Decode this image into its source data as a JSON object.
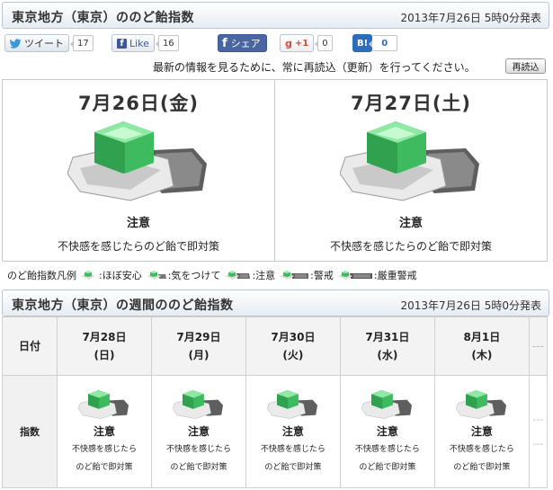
{
  "header": {
    "title": "東京地方（東京）ののど飴指数",
    "issued": "2013年7月26日 5時0分発表"
  },
  "social": {
    "tweet_label": "ツイート",
    "tweet_count": "17",
    "like_label": "Like",
    "like_count": "16",
    "share_label": "シェア",
    "gplus_label": "+1",
    "gplus_count": "0",
    "hatena_label": "B!",
    "hatena_count": "0"
  },
  "notice": {
    "text": "最新の情報を見るために、常に再読込（更新）を行ってください。",
    "reload_label": "再読込"
  },
  "days": [
    {
      "date": "7月26日(金)",
      "level": "注意",
      "desc": "不快感を感じたらのど飴で即対策"
    },
    {
      "date": "7月27日(土)",
      "level": "注意",
      "desc": "不快感を感じたらのど飴で即対策"
    }
  ],
  "legend": {
    "title": "のど飴指数凡例",
    "items": [
      ":ほぼ安心",
      ":気をつけて",
      ":注意",
      ":警戒",
      ":厳重警戒"
    ]
  },
  "weekly": {
    "title": "東京地方（東京）の週間ののど飴指数",
    "issued": "2013年7月26日 5時0分発表",
    "row_date_label": "日付",
    "row_index_label": "指数",
    "dates": [
      {
        "day": "7月28日",
        "weekday": "(日)"
      },
      {
        "day": "7月29日",
        "weekday": "(月)"
      },
      {
        "day": "7月30日",
        "weekday": "(火)"
      },
      {
        "day": "7月31日",
        "weekday": "(水)"
      },
      {
        "day": "8月1日",
        "weekday": "(木)"
      },
      {
        "day": "---",
        "weekday": ""
      }
    ],
    "index": [
      {
        "level": "注意",
        "desc1": "不快感を感じたら",
        "desc2": "のど飴で即対策"
      },
      {
        "level": "注意",
        "desc1": "不快感を感じたら",
        "desc2": "のど飴で即対策"
      },
      {
        "level": "注意",
        "desc1": "不快感を感じたら",
        "desc2": "のど飴で即対策"
      },
      {
        "level": "注意",
        "desc1": "不快感を感じたら",
        "desc2": "のど飴で即対策"
      },
      {
        "level": "注意",
        "desc1": "不快感を感じたら",
        "desc2": "のど飴で即対策"
      },
      {
        "level": "---",
        "desc1": "---",
        "desc2": ""
      }
    ]
  },
  "colors": {
    "candy_green": "#3dbb5e",
    "header_border": "#b9c6d6",
    "facebook_blue": "#3b5998",
    "gplus_red": "#d34836",
    "hatena_blue": "#2c6ebd"
  }
}
